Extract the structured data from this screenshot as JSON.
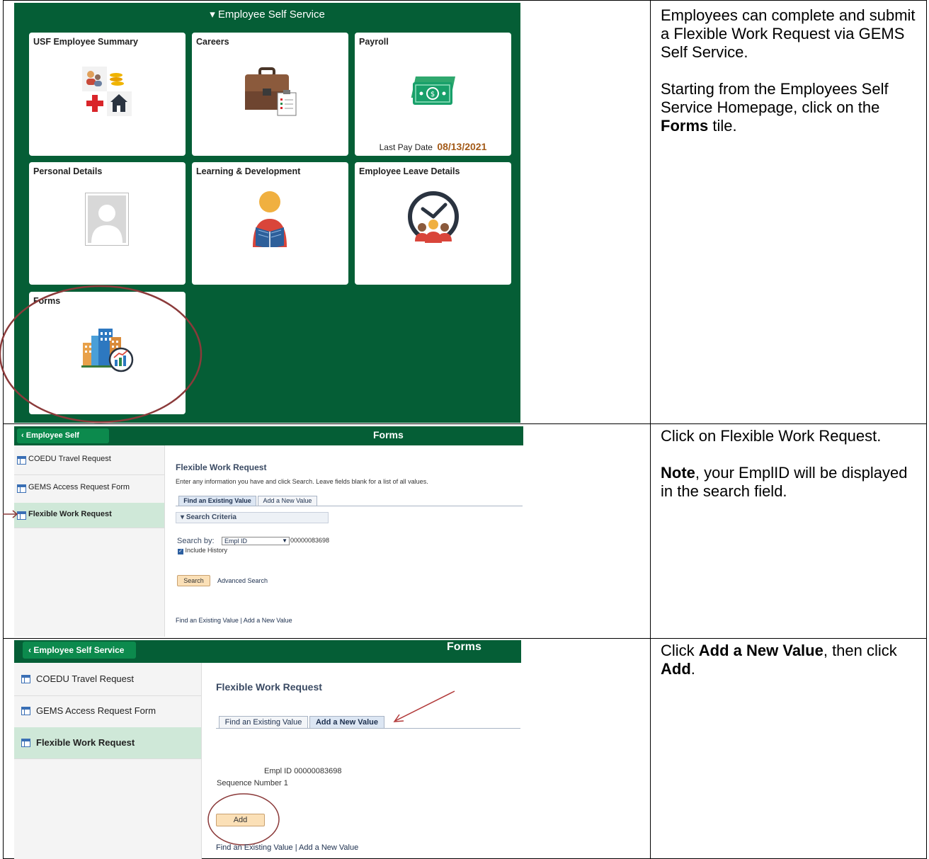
{
  "row1": {
    "ess_header": "▾ Employee Self Service",
    "tiles": [
      {
        "title": "USF Employee Summary"
      },
      {
        "title": "Careers"
      },
      {
        "title": "Payroll",
        "last_pay_label": "Last Pay Date",
        "last_pay_date": "08/13/2021"
      },
      {
        "title": "Personal Details"
      },
      {
        "title": "Learning & Development"
      },
      {
        "title": "Employee Leave Details"
      },
      {
        "title": "Forms"
      }
    ],
    "instructions": {
      "p1": "Employees can complete and submit a Flexible Work Request via GEMS Self Service.",
      "p2_pre": "Starting from the Employees Self Service Homepage, click on the ",
      "p2_bold": "Forms",
      "p2_post": " tile."
    },
    "colors": {
      "ess_green": "#055e36",
      "callout": "#8b3a3a"
    }
  },
  "row2": {
    "back_label": "Employee Self Service",
    "page_title": "Forms",
    "side_items": [
      "COEDU Travel Request",
      "GEMS Access Request Form",
      "Flexible Work Request"
    ],
    "component_title": "Flexible Work Request",
    "help_text": "Enter any information you have and click Search. Leave fields blank for a list of all values.",
    "tab_find": "Find an Existing Value",
    "tab_add": "Add a New Value",
    "search_criteria": "Search Criteria",
    "search_by_label": "Search by:",
    "search_by_value": "Empl ID",
    "empl_id_value": "00000083698",
    "include_history": "Include History",
    "search_btn": "Search",
    "advanced_search": "Advanced Search",
    "footer_find": "Find an Existing Value",
    "footer_sep": "|",
    "footer_add": "Add a New Value",
    "instructions": {
      "p1": "Click on Flexible Work Request.",
      "p2_bold": "Note",
      "p2_post": ", your EmplID will be displayed in the search field."
    }
  },
  "row3": {
    "back_label": "Employee Self Service",
    "page_title": "Forms",
    "side_items": [
      "COEDU Travel Request",
      "GEMS Access Request Form",
      "Flexible Work Request"
    ],
    "component_title": "Flexible Work Request",
    "tab_find": "Find an Existing Value",
    "tab_add": "Add a New Value",
    "empl_id_label": "Empl ID",
    "empl_id_value": "00000083698",
    "seq_label": "Sequence Number",
    "seq_value": "1",
    "add_btn": "Add",
    "footer_find": "Find an Existing Value",
    "footer_sep": "|",
    "footer_add": "Add a New Value",
    "instructions": {
      "t1": "Click ",
      "b1": "Add a New Value",
      "t2": ", then click ",
      "b2": "Add",
      "t3": "."
    }
  }
}
